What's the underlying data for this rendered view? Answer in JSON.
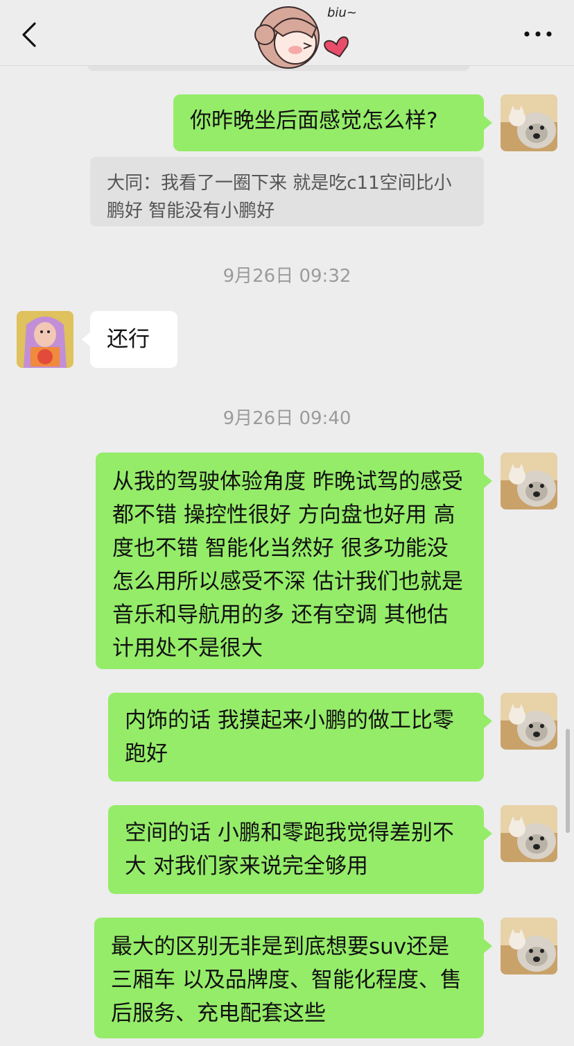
{
  "header": {
    "back_icon": "chevron-left-icon",
    "more_icon": "more-horizontal-icon",
    "sticker_text": "biu~"
  },
  "messages": [
    {
      "id": "m1",
      "side": "me",
      "text": "你昨晚坐后面感觉怎么样?"
    },
    {
      "id": "q1",
      "type": "quote",
      "text": "大同：我看了一圈下来  就是吃c11空间比小鹏好  智能没有小鹏好"
    },
    {
      "id": "t1",
      "type": "time",
      "text": "9月26日 09:32"
    },
    {
      "id": "m2",
      "side": "other",
      "text": "还行"
    },
    {
      "id": "t2",
      "type": "time",
      "text": "9月26日 09:40"
    },
    {
      "id": "m3",
      "side": "me",
      "text": "从我的驾驶体验角度 昨晚试驾的感受都不错 操控性很好 方向盘也好用 高度也不错 智能化当然好 很多功能没怎么用所以感受不深 估计我们也就是音乐和导航用的多 还有空调 其他估计用处不是很大"
    },
    {
      "id": "m4",
      "side": "me",
      "text": "内饰的话 我摸起来小鹏的做工比零跑好"
    },
    {
      "id": "m5",
      "side": "me",
      "text": "空间的话 小鹏和零跑我觉得差别不大 对我们家来说完全够用"
    },
    {
      "id": "m6",
      "side": "me",
      "text": "最大的区别无非是到底想要suv还是三厢车 以及品牌度、智能化程度、售后服务、充电配套这些"
    }
  ],
  "colors": {
    "background": "#ededed",
    "my_bubble": "#95ec69",
    "other_bubble": "#ffffff",
    "quote_bubble": "#e1e1e1",
    "timestamp": "#9b9b9b"
  }
}
